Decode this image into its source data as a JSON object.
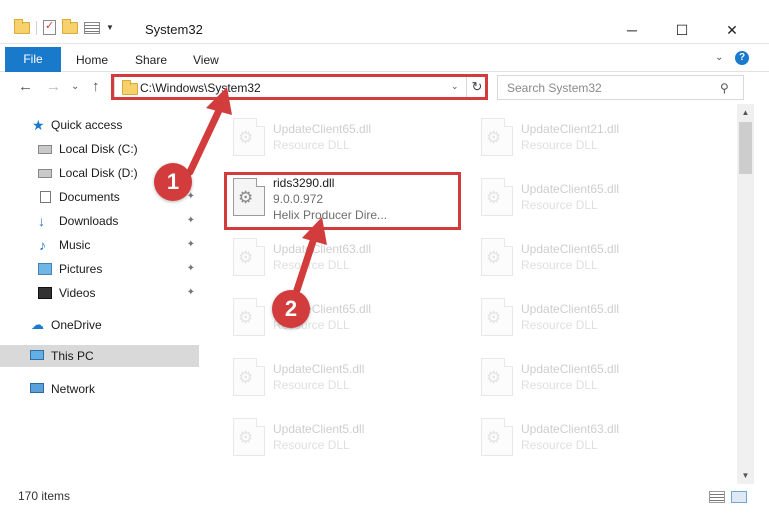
{
  "window": {
    "title": "System32",
    "minimize_glyph": "─",
    "maximize_glyph": "☐",
    "close_glyph": "✕"
  },
  "ribbon": {
    "file": "File",
    "tabs": [
      "Home",
      "Share",
      "View"
    ],
    "collapse_glyph": "⌄",
    "help_glyph": "?"
  },
  "nav": {
    "back_glyph": "←",
    "forward_glyph": "→",
    "recent_glyph": "⌄",
    "up_glyph": "↑",
    "address": "C:\\Windows\\System32",
    "address_dropdown_glyph": "⌄",
    "refresh_glyph": "↻",
    "search_placeholder": "Search System32",
    "search_glyph": "⚲"
  },
  "sidebar": {
    "items": [
      {
        "label": "Quick access",
        "icon": "star-icon"
      },
      {
        "label": "Local Disk (C:)",
        "icon": "disk-icon"
      },
      {
        "label": "Local Disk (D:)",
        "icon": "disk-icon"
      },
      {
        "label": "Documents",
        "icon": "documents-icon",
        "pinned": true
      },
      {
        "label": "Downloads",
        "icon": "downloads-icon",
        "pinned": true
      },
      {
        "label": "Music",
        "icon": "music-icon",
        "pinned": true
      },
      {
        "label": "Pictures",
        "icon": "pictures-icon",
        "pinned": true
      },
      {
        "label": "Videos",
        "icon": "videos-icon",
        "pinned": true
      },
      {
        "label": "OneDrive",
        "icon": "onedrive-icon"
      },
      {
        "label": "This PC",
        "icon": "this-pc-icon",
        "selected": true
      },
      {
        "label": "Network",
        "icon": "network-icon"
      }
    ],
    "pin_glyph": "📌"
  },
  "files": {
    "left": [
      {
        "name": "UpdateClient65.dll",
        "desc": "Resource DLL"
      },
      {
        "name": "rids3290.dll",
        "version": "9.0.0.972",
        "desc": "Helix Producer Dire...",
        "highlight": true
      },
      {
        "name": "UpdateClient63.dll",
        "desc": "Resource DLL"
      },
      {
        "name": "UpdateClient65.dll",
        "desc": "Resource DLL"
      },
      {
        "name": "UpdateClient5.dll",
        "desc": "Resource DLL"
      },
      {
        "name": "UpdateClient5.dll",
        "desc": "Resource DLL"
      }
    ],
    "right": [
      {
        "name": "UpdateClient21.dll",
        "desc": "Resource DLL"
      },
      {
        "name": "UpdateClient65.dll",
        "desc": "Resource DLL"
      },
      {
        "name": "UpdateClient65.dll",
        "desc": "Resource DLL"
      },
      {
        "name": "UpdateClient65.dll",
        "desc": "Resource DLL"
      },
      {
        "name": "UpdateClient65.dll",
        "desc": "Resource DLL"
      },
      {
        "name": "UpdateClient63.dll",
        "desc": "Resource DLL"
      }
    ]
  },
  "scroll": {
    "up_glyph": "▲",
    "down_glyph": "▼"
  },
  "status": {
    "count": "170 items"
  },
  "callouts": {
    "one": "1",
    "two": "2"
  },
  "colors": {
    "accent": "#1979ca",
    "callout": "#d23c3c",
    "highlight": "#d23c3c"
  }
}
